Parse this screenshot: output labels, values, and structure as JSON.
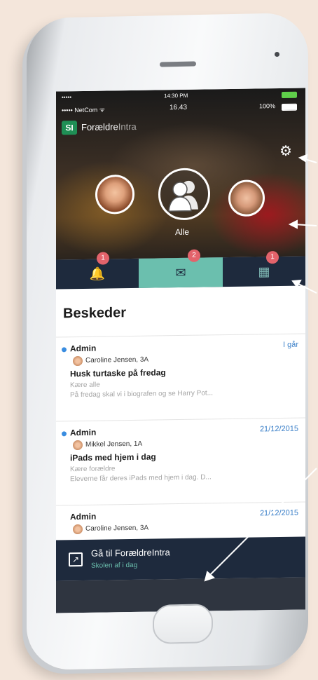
{
  "status": {
    "carrier_top": "•••••",
    "time_top": "14:30 PM",
    "carrier": "••••• NetCom ᯤ",
    "time": "16.43",
    "battery": "100%"
  },
  "app": {
    "logo": "SI",
    "name_strong": "Forældre",
    "name_dim": "Intra",
    "settings_icon": "gear-icon"
  },
  "children": {
    "all_label": "Alle"
  },
  "tabs": [
    {
      "icon": "bell-icon",
      "glyph": "🔔",
      "badge": "1",
      "active": false
    },
    {
      "icon": "envelope-icon",
      "glyph": "✉",
      "badge": "2",
      "active": true
    },
    {
      "icon": "calendar-icon",
      "glyph": "▦",
      "badge": "1",
      "active": false
    }
  ],
  "messages_title": "Beskeder",
  "messages": [
    {
      "sender": "Admin",
      "unread": true,
      "date": "I går",
      "student": "Caroline Jensen, 3A",
      "subject": "Husk turtaske på fredag",
      "greeting": "Kære alle",
      "preview": "På fredag skal vi i biografen og se Harry Pot..."
    },
    {
      "sender": "Admin",
      "unread": true,
      "date": "21/12/2015",
      "student": "Mikkel Jensen, 1A",
      "subject": "iPads med hjem i dag",
      "greeting": "Kære forældre",
      "preview": "Eleverne får deres iPads med hjem i dag. D..."
    },
    {
      "sender": "Admin",
      "unread": false,
      "date": "21/12/2015",
      "student": "Caroline Jensen, 3A",
      "subject": "",
      "greeting": "",
      "preview": ""
    }
  ],
  "goto": {
    "title": "Gå til ForældreIntra",
    "subtitle": "Skolen af i dag"
  },
  "colors": {
    "navy": "#1e2a3d",
    "teal": "#6bbfae",
    "badge": "#e3636b",
    "unread_dot": "#3a8de0",
    "logo_green": "#1f8f55"
  }
}
